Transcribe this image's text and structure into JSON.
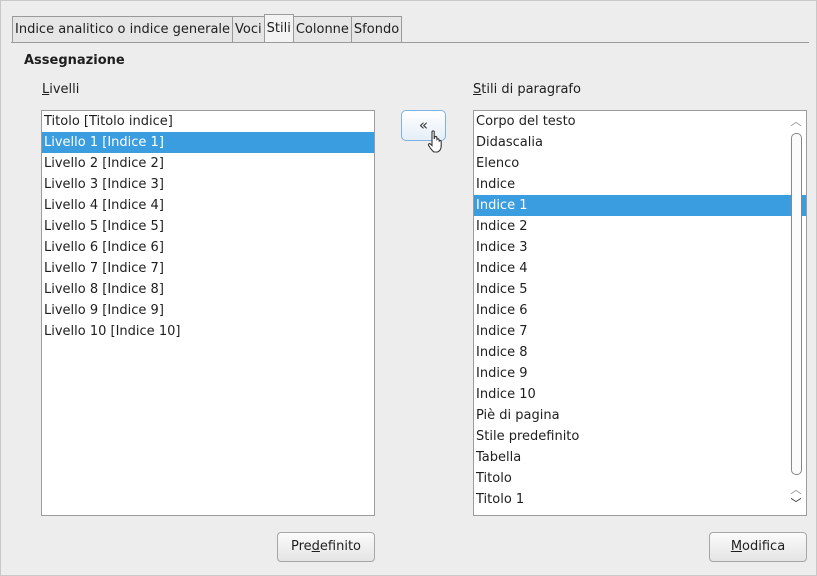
{
  "tabs": [
    {
      "label": "Indice analitico o indice generale",
      "active": false
    },
    {
      "label": "Voci",
      "active": false
    },
    {
      "label": "Stili",
      "active": true
    },
    {
      "label": "Colonne",
      "active": false
    },
    {
      "label": "Sfondo",
      "active": false
    }
  ],
  "assignment": {
    "title": "Assegnazione",
    "levels_label_mnemonic": "L",
    "levels_label_rest": "ivelli",
    "styles_label_mnemonic": "S",
    "styles_label_rest": "tili di paragrafo",
    "assign_button_glyph": "«",
    "levels": [
      "Titolo [Titolo indice]",
      "Livello 1 [Indice 1]",
      "Livello 2 [Indice 2]",
      "Livello 3 [Indice 3]",
      "Livello 4 [Indice 4]",
      "Livello 5 [Indice 5]",
      "Livello 6 [Indice 6]",
      "Livello 7 [Indice 7]",
      "Livello 8 [Indice 8]",
      "Livello 9 [Indice 9]",
      "Livello 10 [Indice 10]"
    ],
    "levels_selected_index": 1,
    "styles": [
      "Corpo del testo",
      "Didascalia",
      "Elenco",
      "Indice",
      "Indice 1",
      "Indice 2",
      "Indice 3",
      "Indice 4",
      "Indice 5",
      "Indice 6",
      "Indice 7",
      "Indice 8",
      "Indice 9",
      "Indice 10",
      "Piè di pagina",
      "Stile predefinito",
      "Tabella",
      "Titolo",
      "Titolo 1"
    ],
    "styles_selected_index": 4
  },
  "buttons": {
    "default_pre": "Pre",
    "default_mnemonic": "d",
    "default_post": "efinito",
    "modify_mnemonic": "M",
    "modify_post": "odifica"
  },
  "colors": {
    "selection": "#3a9de0",
    "background": "#ededed"
  }
}
